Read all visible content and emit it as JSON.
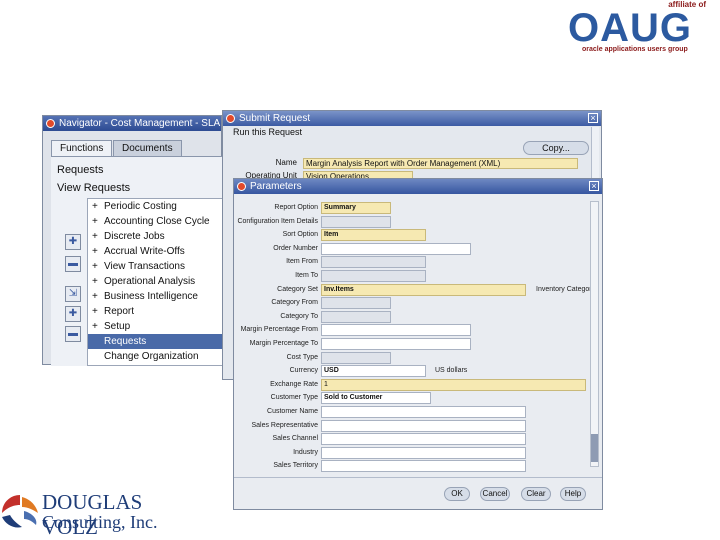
{
  "oaug": {
    "affiliate": "affiliate of",
    "wordmark": "OAUG",
    "tagline": "oracle applications users group"
  },
  "dv": {
    "line1": "DOUGLAS VOLZ",
    "line2": "Consulting, Inc."
  },
  "navigator": {
    "title": "Navigator - Cost Management - SLA Vis",
    "tabs": [
      "Functions",
      "Documents"
    ],
    "top_items": [
      "Requests",
      "View Requests"
    ],
    "items": [
      {
        "prefix": "+",
        "label": "Periodic Costing"
      },
      {
        "prefix": "+",
        "label": "Accounting Close Cycle"
      },
      {
        "prefix": "+",
        "label": "Discrete Jobs"
      },
      {
        "prefix": "+",
        "label": "Accrual Write-Offs"
      },
      {
        "prefix": "+",
        "label": "View Transactions"
      },
      {
        "prefix": "+",
        "label": "Operational Analysis"
      },
      {
        "prefix": "+",
        "label": "Business Intelligence"
      },
      {
        "prefix": "+",
        "label": "Report"
      },
      {
        "prefix": "+",
        "label": "Setup"
      },
      {
        "prefix": "",
        "label": "Requests",
        "selected": true
      },
      {
        "prefix": "",
        "label": "Change Organization"
      }
    ]
  },
  "submit": {
    "title": "Submit Request",
    "run_label": "Run this Request",
    "copy_button": "Copy...",
    "name_label": "Name",
    "name_value": "Margin Analysis Report with Order Management (XML)",
    "operating_unit_label": "Operating Unit",
    "operating_unit_value": "Vision Operations"
  },
  "parameters": {
    "title": "Parameters",
    "fields": [
      {
        "label": "Report Option",
        "value": "Summary",
        "kind": "req",
        "bold": true,
        "width": 70
      },
      {
        "label": "Configuration Item Details",
        "value": "",
        "kind": "ro",
        "width": 70
      },
      {
        "label": "Sort Option",
        "value": "Item",
        "kind": "req",
        "bold": true,
        "width": 105
      },
      {
        "label": "Order Number",
        "value": "",
        "kind": "",
        "width": 150
      },
      {
        "label": "Item From",
        "value": "",
        "kind": "ro",
        "width": 105
      },
      {
        "label": "Item To",
        "value": "",
        "kind": "ro",
        "width": 105
      },
      {
        "label": "Category Set",
        "value": "Inv.Items",
        "kind": "req",
        "bold": true,
        "width": 205
      },
      {
        "label": "Category From",
        "value": "",
        "kind": "ro",
        "width": 70
      },
      {
        "label": "Category To",
        "value": "",
        "kind": "ro",
        "width": 70
      },
      {
        "label": "Margin Percentage From",
        "value": "",
        "kind": "",
        "width": 150
      },
      {
        "label": "Margin Percentage To",
        "value": "",
        "kind": "",
        "width": 150
      },
      {
        "label": "Cost Type",
        "value": "",
        "kind": "ro",
        "width": 70
      },
      {
        "label": "Currency",
        "value": "USD",
        "kind": "",
        "bold": true,
        "width": 105
      },
      {
        "label": "Exchange Rate",
        "value": "1",
        "kind": "req",
        "width": 265
      },
      {
        "label": "Customer Type",
        "value": "Sold to Customer",
        "kind": "",
        "bold": true,
        "width": 110
      },
      {
        "label": "Customer Name",
        "value": "",
        "kind": "",
        "width": 205
      },
      {
        "label": "Sales Representative",
        "value": "",
        "kind": "",
        "width": 205
      },
      {
        "label": "Sales Channel",
        "value": "",
        "kind": "",
        "width": 205
      },
      {
        "label": "Industry",
        "value": "",
        "kind": "",
        "width": 205
      },
      {
        "label": "Sales Territory",
        "value": "",
        "kind": "",
        "width": 205
      }
    ],
    "side_notes": {
      "category_set": "Inventory Categor",
      "currency": "US dollars"
    },
    "buttons": [
      "OK",
      "Cancel",
      "Clear",
      "Help"
    ]
  }
}
